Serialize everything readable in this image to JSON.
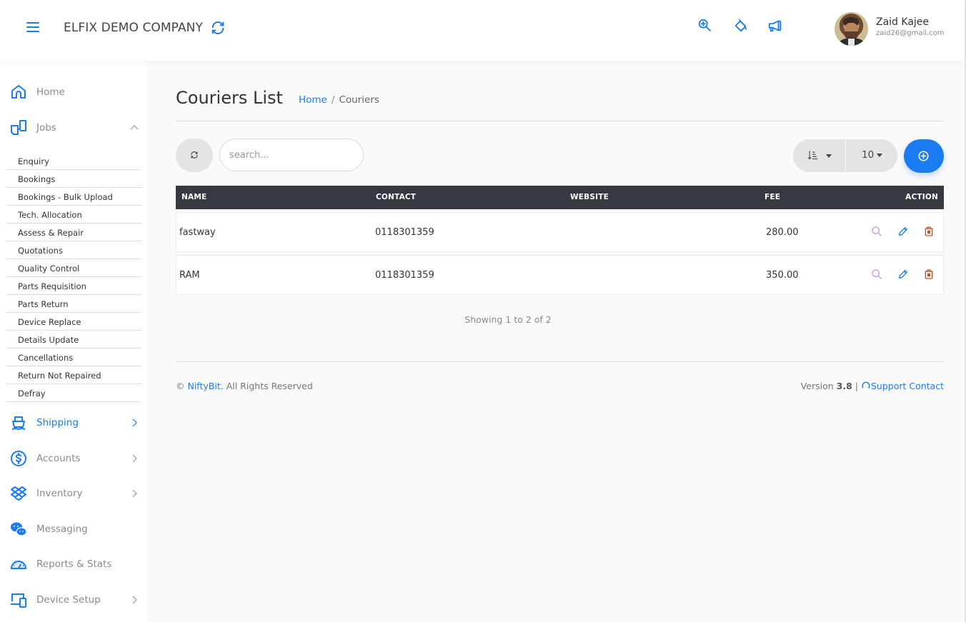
{
  "header": {
    "company_name": "ELFIX DEMO COMPANY",
    "icons": [
      "zoom-in-icon",
      "paint-bucket-icon",
      "megaphone-icon"
    ],
    "user": {
      "name": "Zaid Kajee",
      "email": "zaid26@gmail.com"
    }
  },
  "sidebar": {
    "items": [
      {
        "label": "Home",
        "icon": "home-icon"
      },
      {
        "label": "Jobs",
        "icon": "jobs-icon",
        "expanded": true
      },
      {
        "label": "Shipping",
        "icon": "ship-icon",
        "active": true
      },
      {
        "label": "Accounts",
        "icon": "dollar-icon"
      },
      {
        "label": "Inventory",
        "icon": "dropbox-icon"
      },
      {
        "label": "Messaging",
        "icon": "chat-icon"
      },
      {
        "label": "Reports & Stats",
        "icon": "dashboard-icon"
      },
      {
        "label": "Device Setup",
        "icon": "devices-icon"
      }
    ],
    "jobs_submenu": [
      "Enquiry",
      "Bookings",
      "Bookings - Bulk Upload",
      "Tech. Allocation",
      "Assess & Repair",
      "Quotations",
      "Quality Control",
      "Parts Requisition",
      "Parts Return",
      "Device Replace",
      "Details Update",
      "Cancellations",
      "Return Not Repaired",
      "Defray"
    ]
  },
  "page": {
    "title": "Couriers List",
    "breadcrumb": {
      "home": "Home",
      "separator": "/",
      "current": "Couriers"
    }
  },
  "toolbar": {
    "search_placeholder": "search...",
    "search_value": "",
    "per_page": "10"
  },
  "table": {
    "columns": [
      "NAME",
      "CONTACT",
      "WEBSITE",
      "FEE",
      "ACTION"
    ],
    "rows": [
      {
        "name": "fastway",
        "contact": "0118301359",
        "website": "",
        "fee": "280.00"
      },
      {
        "name": "RAM",
        "contact": "0118301359",
        "website": "",
        "fee": "350.00"
      }
    ],
    "showing": "Showing 1 to 2 of 2"
  },
  "footer": {
    "copyright_symbol": "©",
    "brand": "NiftyBit.",
    "rights": "All Rights Reserved",
    "version_label": "Version",
    "version": "3.8",
    "divider": "|",
    "support": "Support Contact"
  },
  "colors": {
    "accent": "#1a7cf0",
    "table_header": "#343a40",
    "view_icon": "#c79be8",
    "delete_icon": "#c0552b"
  }
}
